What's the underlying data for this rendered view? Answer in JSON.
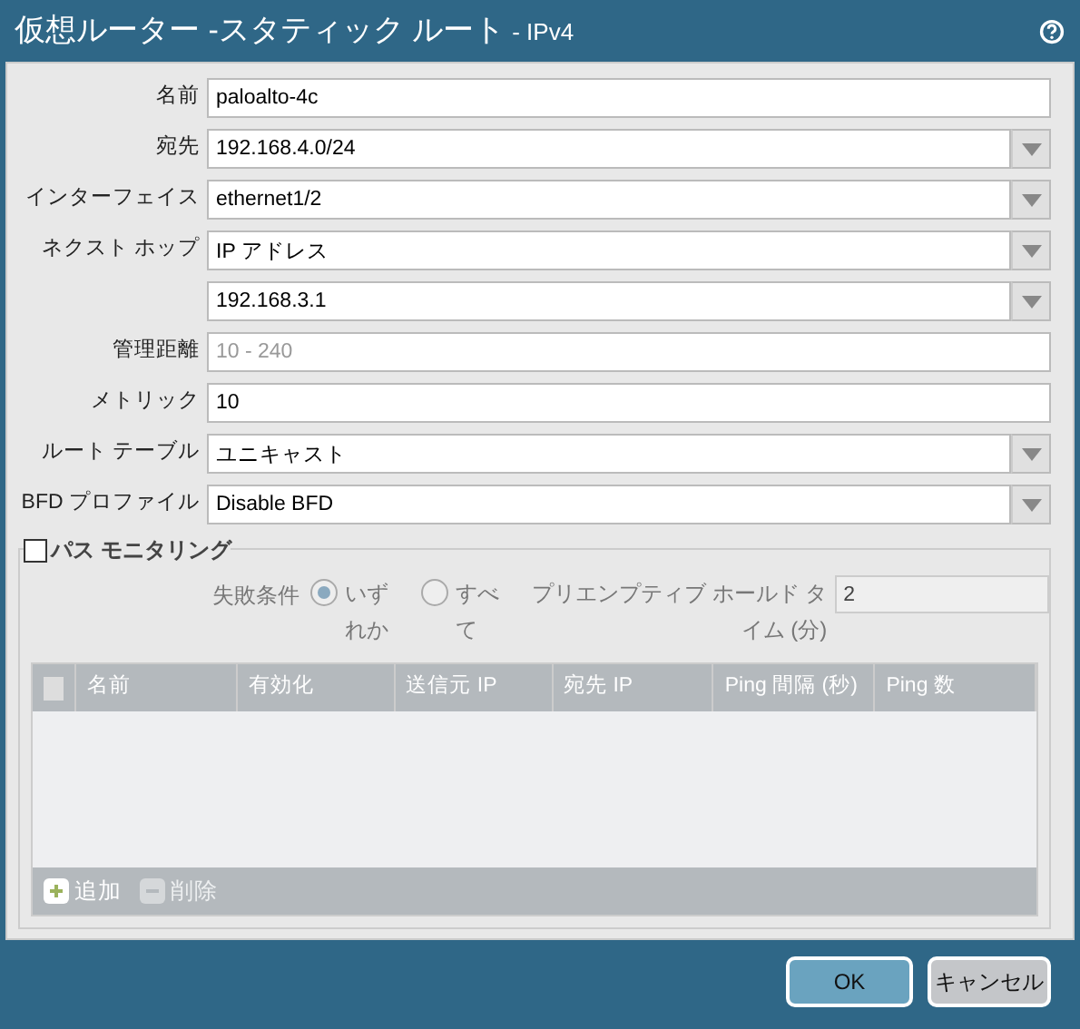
{
  "window": {
    "title": "仮想ルーター -スタティック ルート",
    "subtitle": "- IPv4"
  },
  "fields": [
    {
      "label": "名前",
      "kind": "text",
      "value": "paloalto-4c"
    },
    {
      "label": "宛先",
      "kind": "select",
      "value": "192.168.4.0/24"
    },
    {
      "label": "インターフェイス",
      "kind": "select",
      "value": "ethernet1/2"
    },
    {
      "label": "ネクスト ホップ",
      "kind": "select",
      "value": "IP アドレス"
    },
    {
      "kind": "select",
      "value": "192.168.3.1"
    },
    {
      "label": "管理距離",
      "kind": "text",
      "placeholder": "10 - 240"
    },
    {
      "label": "メトリック",
      "kind": "text",
      "value": "10"
    },
    {
      "label": "ルート テーブル",
      "kind": "select",
      "value": "ユニキャスト"
    },
    {
      "label": "BFD プロファイル",
      "kind": "select",
      "value": "Disable BFD"
    }
  ],
  "path_monitoring": {
    "label": "パス モニタリング",
    "checked": false,
    "disabled": true,
    "failure_condition": {
      "label": "失敗条件",
      "options": [
        {
          "label": "いずれか",
          "selected": true
        },
        {
          "label": "すべて",
          "selected": false
        }
      ]
    },
    "preemptive_hold": {
      "label_lines": [
        "プリエンプティブ ホールド タ",
        "イム (分)"
      ],
      "value": "2"
    },
    "table": {
      "select_all_checked": false,
      "columns": [
        "名前",
        "有効化",
        "送信元 IP",
        "宛先 IP",
        "Ping 間隔 (秒)",
        "Ping 数"
      ]
    },
    "actions": [
      {
        "label": "追加",
        "kind": "add",
        "disabled": false
      },
      {
        "label": "削除",
        "kind": "delete",
        "disabled": true
      }
    ]
  },
  "buttons": [
    {
      "label": "OK",
      "kind": "primary"
    },
    {
      "label": "キャンセル",
      "kind": "secondary"
    }
  ]
}
